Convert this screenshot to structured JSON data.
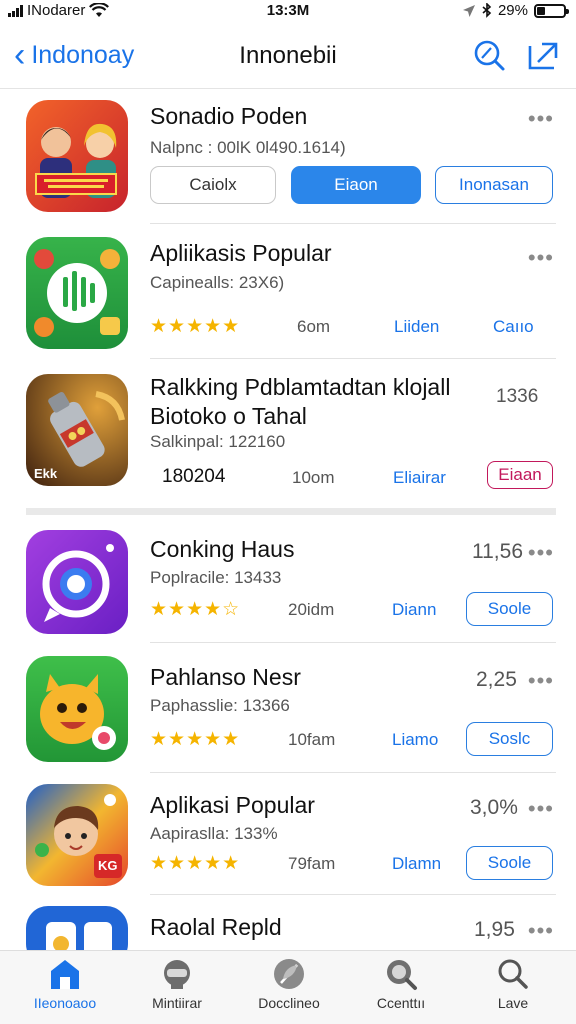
{
  "status_bar": {
    "carrier": "INodarer",
    "time": "13:3M",
    "battery": "29%",
    "battery_level": 0.29
  },
  "nav": {
    "back_label": "Indonoay",
    "title": "Innonebii"
  },
  "apps": [
    {
      "name": "Sonadio Poden",
      "subtitle": "Nalpnc : 00lK 0l490.1614)",
      "buttons": [
        "Caiolx",
        "Eiaon",
        "Inonasan"
      ]
    },
    {
      "name": "Apliikasis Popular",
      "subtitle": "Capinealls: 23X6)",
      "size": "6om",
      "link1": "Liiden",
      "link2": "Caııo"
    },
    {
      "name_line1": "Ralkking Pdblamtadtan klojall",
      "name_line2": "Biotoko o Tahal",
      "subtitle": "Salkinpal: 122160",
      "price": "1336",
      "number": "180204",
      "size": "10om",
      "link": "Eliairar",
      "button": "Eiaan",
      "icon_text": "Ekk"
    },
    {
      "name": "Conking Haus",
      "subtitle": "Poplracile: 13433",
      "price": "11,56",
      "size": "20idm",
      "link": "Diann",
      "button": "Soole"
    },
    {
      "name": "Pahlanso Nesr",
      "subtitle": "Paphasslie: 13366",
      "price": "2,25",
      "size": "10fam",
      "link": "Liamo",
      "button": "Soslc"
    },
    {
      "name": "Aplikasi Popular",
      "subtitle": "Aapiraslla: 133%",
      "price": "3,0%",
      "size": "79fam",
      "link": "Dlamn",
      "button": "Soole",
      "icon_text": "KG"
    },
    {
      "name": "Raolal Repld",
      "price": "1,95"
    }
  ],
  "tabs": [
    {
      "label": "IIeonoaoo",
      "icon": "store-icon"
    },
    {
      "label": "Mintiirar",
      "icon": "robot-icon"
    },
    {
      "label": "Docclineo",
      "icon": "leaf-icon"
    },
    {
      "label": "Ccenttıı",
      "icon": "magnifier-icon"
    },
    {
      "label": "Lave",
      "icon": "search-icon"
    }
  ],
  "colors": {
    "accent": "#1a73e8",
    "star": "#f5b400",
    "danger": "#c2185b"
  }
}
